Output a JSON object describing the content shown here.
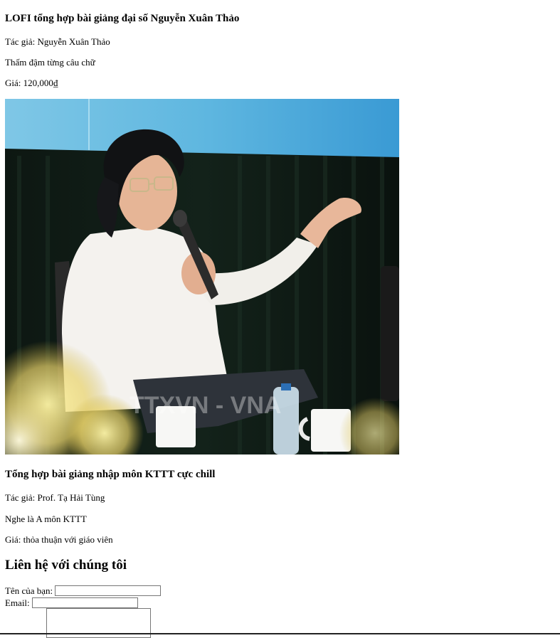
{
  "products": [
    {
      "title": "LOFI tổng hợp bài giảng đại số Nguyễn Xuân Thảo",
      "author": "Tác giả: Nguyễn Xuân Thảo",
      "description": "Thấm đậm từng câu chữ",
      "price": "Giá: 120,000₫",
      "image_watermark": "TTXVN - VNA"
    },
    {
      "title": "Tổng hợp bài giảng nhập môn KTTT cực chill",
      "author": "Tác giả: Prof. Tạ Hải Tùng",
      "description": "Nghe là A môn KTTT",
      "price": "Giá: thỏa thuận với giáo viên"
    }
  ],
  "contact": {
    "heading": "Liên hệ với chúng tôi",
    "name_label": "Tên của bạn:",
    "name_value": "",
    "email_label": "Email:",
    "email_value": "",
    "message_value": ""
  }
}
